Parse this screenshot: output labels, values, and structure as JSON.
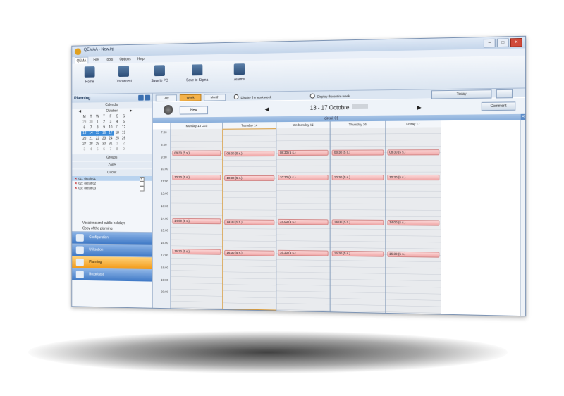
{
  "window": {
    "title": "QEMAA - New.irp",
    "min": "–",
    "max": "□",
    "close": "✕"
  },
  "menu": [
    "QEMA",
    "File",
    "Tools",
    "Options",
    "Help"
  ],
  "ribbon": [
    "Home",
    "Disconnect",
    "Save to PC",
    "Save to Sigma",
    "Alarms"
  ],
  "sidebar": {
    "title": "Planning",
    "calendar_label": "Calendar",
    "month": "October",
    "prev": "◀",
    "next": "▶",
    "weekdays": [
      "M",
      "T",
      "W",
      "T",
      "F",
      "S",
      "S"
    ],
    "days": [
      [
        "29",
        "30",
        "1",
        "2",
        "3",
        "4",
        "5"
      ],
      [
        "6",
        "7",
        "8",
        "9",
        "10",
        "11",
        "12"
      ],
      [
        "13",
        "14",
        "15",
        "16",
        "17",
        "18",
        "19"
      ],
      [
        "20",
        "21",
        "22",
        "23",
        "24",
        "25",
        "26"
      ],
      [
        "27",
        "28",
        "29",
        "30",
        "31",
        "1",
        "2"
      ],
      [
        "3",
        "4",
        "5",
        "6",
        "7",
        "8",
        "9"
      ]
    ],
    "sections": [
      "Groups",
      "Zone",
      "Circuit"
    ],
    "circuits": [
      "01 : circuit 01",
      "02 : circuit 02",
      "03 : circuit 03"
    ],
    "links": [
      "Vacations and public holidays",
      "Copy of the planning"
    ],
    "nav": [
      "Configuration",
      "Utilisation",
      "Planning",
      "Broadcast"
    ]
  },
  "viewbar": {
    "day": "Day",
    "week": "Week",
    "month": "Month",
    "work_week": "Display the work week",
    "entire_week": "Display the entire week",
    "today": "Today"
  },
  "toolbar": {
    "new": "New",
    "prev": "◀",
    "next": "▶",
    "week_range": "13 - 17 Octobre",
    "comment": "Comment"
  },
  "planning": {
    "circuit": "circuit 01",
    "days": [
      "Monday 13 Oct)",
      "Tuesday 14",
      "Wednesday 15",
      "Thursday 16",
      "Friday 17"
    ],
    "hours": [
      "7:00",
      "8:00",
      "9:00",
      "10:00",
      "11:00",
      "12:00",
      "13:00",
      "14:00",
      "15:00",
      "16:00",
      "17:00",
      "18:00",
      "19:00",
      "20:00"
    ],
    "event_label": "(5 s.)",
    "events": [
      {
        "day": 0,
        "time": "08:30"
      },
      {
        "day": 1,
        "time": "08:30"
      },
      {
        "day": 2,
        "time": "08:30"
      },
      {
        "day": 3,
        "time": "08:30"
      },
      {
        "day": 4,
        "time": "08:30"
      },
      {
        "day": 0,
        "time": "10:30"
      },
      {
        "day": 1,
        "time": "10:30"
      },
      {
        "day": 2,
        "time": "10:30"
      },
      {
        "day": 3,
        "time": "10:30"
      },
      {
        "day": 4,
        "time": "10:30"
      },
      {
        "day": 0,
        "time": "14:00"
      },
      {
        "day": 1,
        "time": "14:00"
      },
      {
        "day": 2,
        "time": "14:00"
      },
      {
        "day": 3,
        "time": "14:00"
      },
      {
        "day": 4,
        "time": "14:00"
      },
      {
        "day": 0,
        "time": "16:30"
      },
      {
        "day": 1,
        "time": "16:30"
      },
      {
        "day": 2,
        "time": "16:30"
      },
      {
        "day": 3,
        "time": "16:30"
      },
      {
        "day": 4,
        "time": "16:30"
      }
    ]
  }
}
